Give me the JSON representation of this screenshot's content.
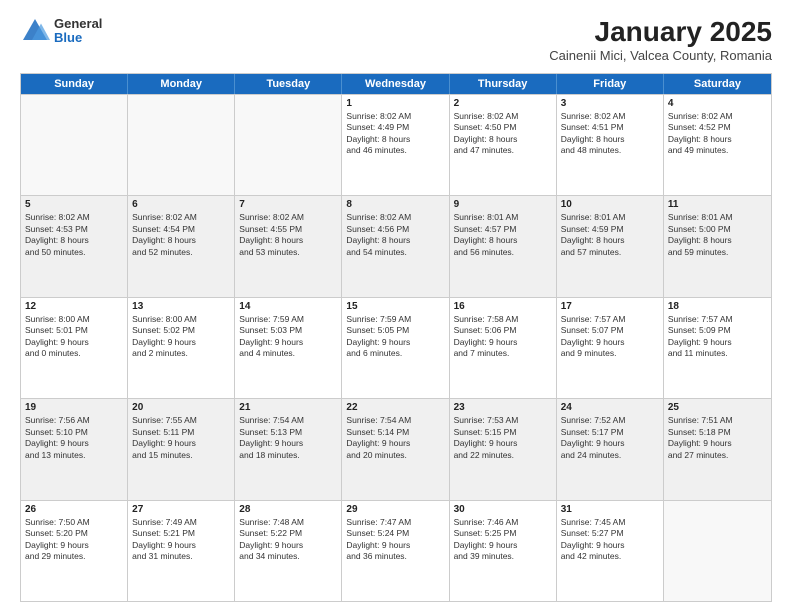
{
  "logo": {
    "general": "General",
    "blue": "Blue"
  },
  "title": "January 2025",
  "subtitle": "Cainenii Mici, Valcea County, Romania",
  "header_days": [
    "Sunday",
    "Monday",
    "Tuesday",
    "Wednesday",
    "Thursday",
    "Friday",
    "Saturday"
  ],
  "weeks": [
    [
      {
        "day": "",
        "empty": true
      },
      {
        "day": "",
        "empty": true
      },
      {
        "day": "",
        "empty": true
      },
      {
        "day": "1",
        "lines": [
          "Sunrise: 8:02 AM",
          "Sunset: 4:49 PM",
          "Daylight: 8 hours",
          "and 46 minutes."
        ]
      },
      {
        "day": "2",
        "lines": [
          "Sunrise: 8:02 AM",
          "Sunset: 4:50 PM",
          "Daylight: 8 hours",
          "and 47 minutes."
        ]
      },
      {
        "day": "3",
        "lines": [
          "Sunrise: 8:02 AM",
          "Sunset: 4:51 PM",
          "Daylight: 8 hours",
          "and 48 minutes."
        ]
      },
      {
        "day": "4",
        "lines": [
          "Sunrise: 8:02 AM",
          "Sunset: 4:52 PM",
          "Daylight: 8 hours",
          "and 49 minutes."
        ]
      }
    ],
    [
      {
        "day": "5",
        "lines": [
          "Sunrise: 8:02 AM",
          "Sunset: 4:53 PM",
          "Daylight: 8 hours",
          "and 50 minutes."
        ]
      },
      {
        "day": "6",
        "lines": [
          "Sunrise: 8:02 AM",
          "Sunset: 4:54 PM",
          "Daylight: 8 hours",
          "and 52 minutes."
        ]
      },
      {
        "day": "7",
        "lines": [
          "Sunrise: 8:02 AM",
          "Sunset: 4:55 PM",
          "Daylight: 8 hours",
          "and 53 minutes."
        ]
      },
      {
        "day": "8",
        "lines": [
          "Sunrise: 8:02 AM",
          "Sunset: 4:56 PM",
          "Daylight: 8 hours",
          "and 54 minutes."
        ]
      },
      {
        "day": "9",
        "lines": [
          "Sunrise: 8:01 AM",
          "Sunset: 4:57 PM",
          "Daylight: 8 hours",
          "and 56 minutes."
        ]
      },
      {
        "day": "10",
        "lines": [
          "Sunrise: 8:01 AM",
          "Sunset: 4:59 PM",
          "Daylight: 8 hours",
          "and 57 minutes."
        ]
      },
      {
        "day": "11",
        "lines": [
          "Sunrise: 8:01 AM",
          "Sunset: 5:00 PM",
          "Daylight: 8 hours",
          "and 59 minutes."
        ]
      }
    ],
    [
      {
        "day": "12",
        "lines": [
          "Sunrise: 8:00 AM",
          "Sunset: 5:01 PM",
          "Daylight: 9 hours",
          "and 0 minutes."
        ]
      },
      {
        "day": "13",
        "lines": [
          "Sunrise: 8:00 AM",
          "Sunset: 5:02 PM",
          "Daylight: 9 hours",
          "and 2 minutes."
        ]
      },
      {
        "day": "14",
        "lines": [
          "Sunrise: 7:59 AM",
          "Sunset: 5:03 PM",
          "Daylight: 9 hours",
          "and 4 minutes."
        ]
      },
      {
        "day": "15",
        "lines": [
          "Sunrise: 7:59 AM",
          "Sunset: 5:05 PM",
          "Daylight: 9 hours",
          "and 6 minutes."
        ]
      },
      {
        "day": "16",
        "lines": [
          "Sunrise: 7:58 AM",
          "Sunset: 5:06 PM",
          "Daylight: 9 hours",
          "and 7 minutes."
        ]
      },
      {
        "day": "17",
        "lines": [
          "Sunrise: 7:57 AM",
          "Sunset: 5:07 PM",
          "Daylight: 9 hours",
          "and 9 minutes."
        ]
      },
      {
        "day": "18",
        "lines": [
          "Sunrise: 7:57 AM",
          "Sunset: 5:09 PM",
          "Daylight: 9 hours",
          "and 11 minutes."
        ]
      }
    ],
    [
      {
        "day": "19",
        "lines": [
          "Sunrise: 7:56 AM",
          "Sunset: 5:10 PM",
          "Daylight: 9 hours",
          "and 13 minutes."
        ]
      },
      {
        "day": "20",
        "lines": [
          "Sunrise: 7:55 AM",
          "Sunset: 5:11 PM",
          "Daylight: 9 hours",
          "and 15 minutes."
        ]
      },
      {
        "day": "21",
        "lines": [
          "Sunrise: 7:54 AM",
          "Sunset: 5:13 PM",
          "Daylight: 9 hours",
          "and 18 minutes."
        ]
      },
      {
        "day": "22",
        "lines": [
          "Sunrise: 7:54 AM",
          "Sunset: 5:14 PM",
          "Daylight: 9 hours",
          "and 20 minutes."
        ]
      },
      {
        "day": "23",
        "lines": [
          "Sunrise: 7:53 AM",
          "Sunset: 5:15 PM",
          "Daylight: 9 hours",
          "and 22 minutes."
        ]
      },
      {
        "day": "24",
        "lines": [
          "Sunrise: 7:52 AM",
          "Sunset: 5:17 PM",
          "Daylight: 9 hours",
          "and 24 minutes."
        ]
      },
      {
        "day": "25",
        "lines": [
          "Sunrise: 7:51 AM",
          "Sunset: 5:18 PM",
          "Daylight: 9 hours",
          "and 27 minutes."
        ]
      }
    ],
    [
      {
        "day": "26",
        "lines": [
          "Sunrise: 7:50 AM",
          "Sunset: 5:20 PM",
          "Daylight: 9 hours",
          "and 29 minutes."
        ]
      },
      {
        "day": "27",
        "lines": [
          "Sunrise: 7:49 AM",
          "Sunset: 5:21 PM",
          "Daylight: 9 hours",
          "and 31 minutes."
        ]
      },
      {
        "day": "28",
        "lines": [
          "Sunrise: 7:48 AM",
          "Sunset: 5:22 PM",
          "Daylight: 9 hours",
          "and 34 minutes."
        ]
      },
      {
        "day": "29",
        "lines": [
          "Sunrise: 7:47 AM",
          "Sunset: 5:24 PM",
          "Daylight: 9 hours",
          "and 36 minutes."
        ]
      },
      {
        "day": "30",
        "lines": [
          "Sunrise: 7:46 AM",
          "Sunset: 5:25 PM",
          "Daylight: 9 hours",
          "and 39 minutes."
        ]
      },
      {
        "day": "31",
        "lines": [
          "Sunrise: 7:45 AM",
          "Sunset: 5:27 PM",
          "Daylight: 9 hours",
          "and 42 minutes."
        ]
      },
      {
        "day": "",
        "empty": true
      }
    ]
  ]
}
